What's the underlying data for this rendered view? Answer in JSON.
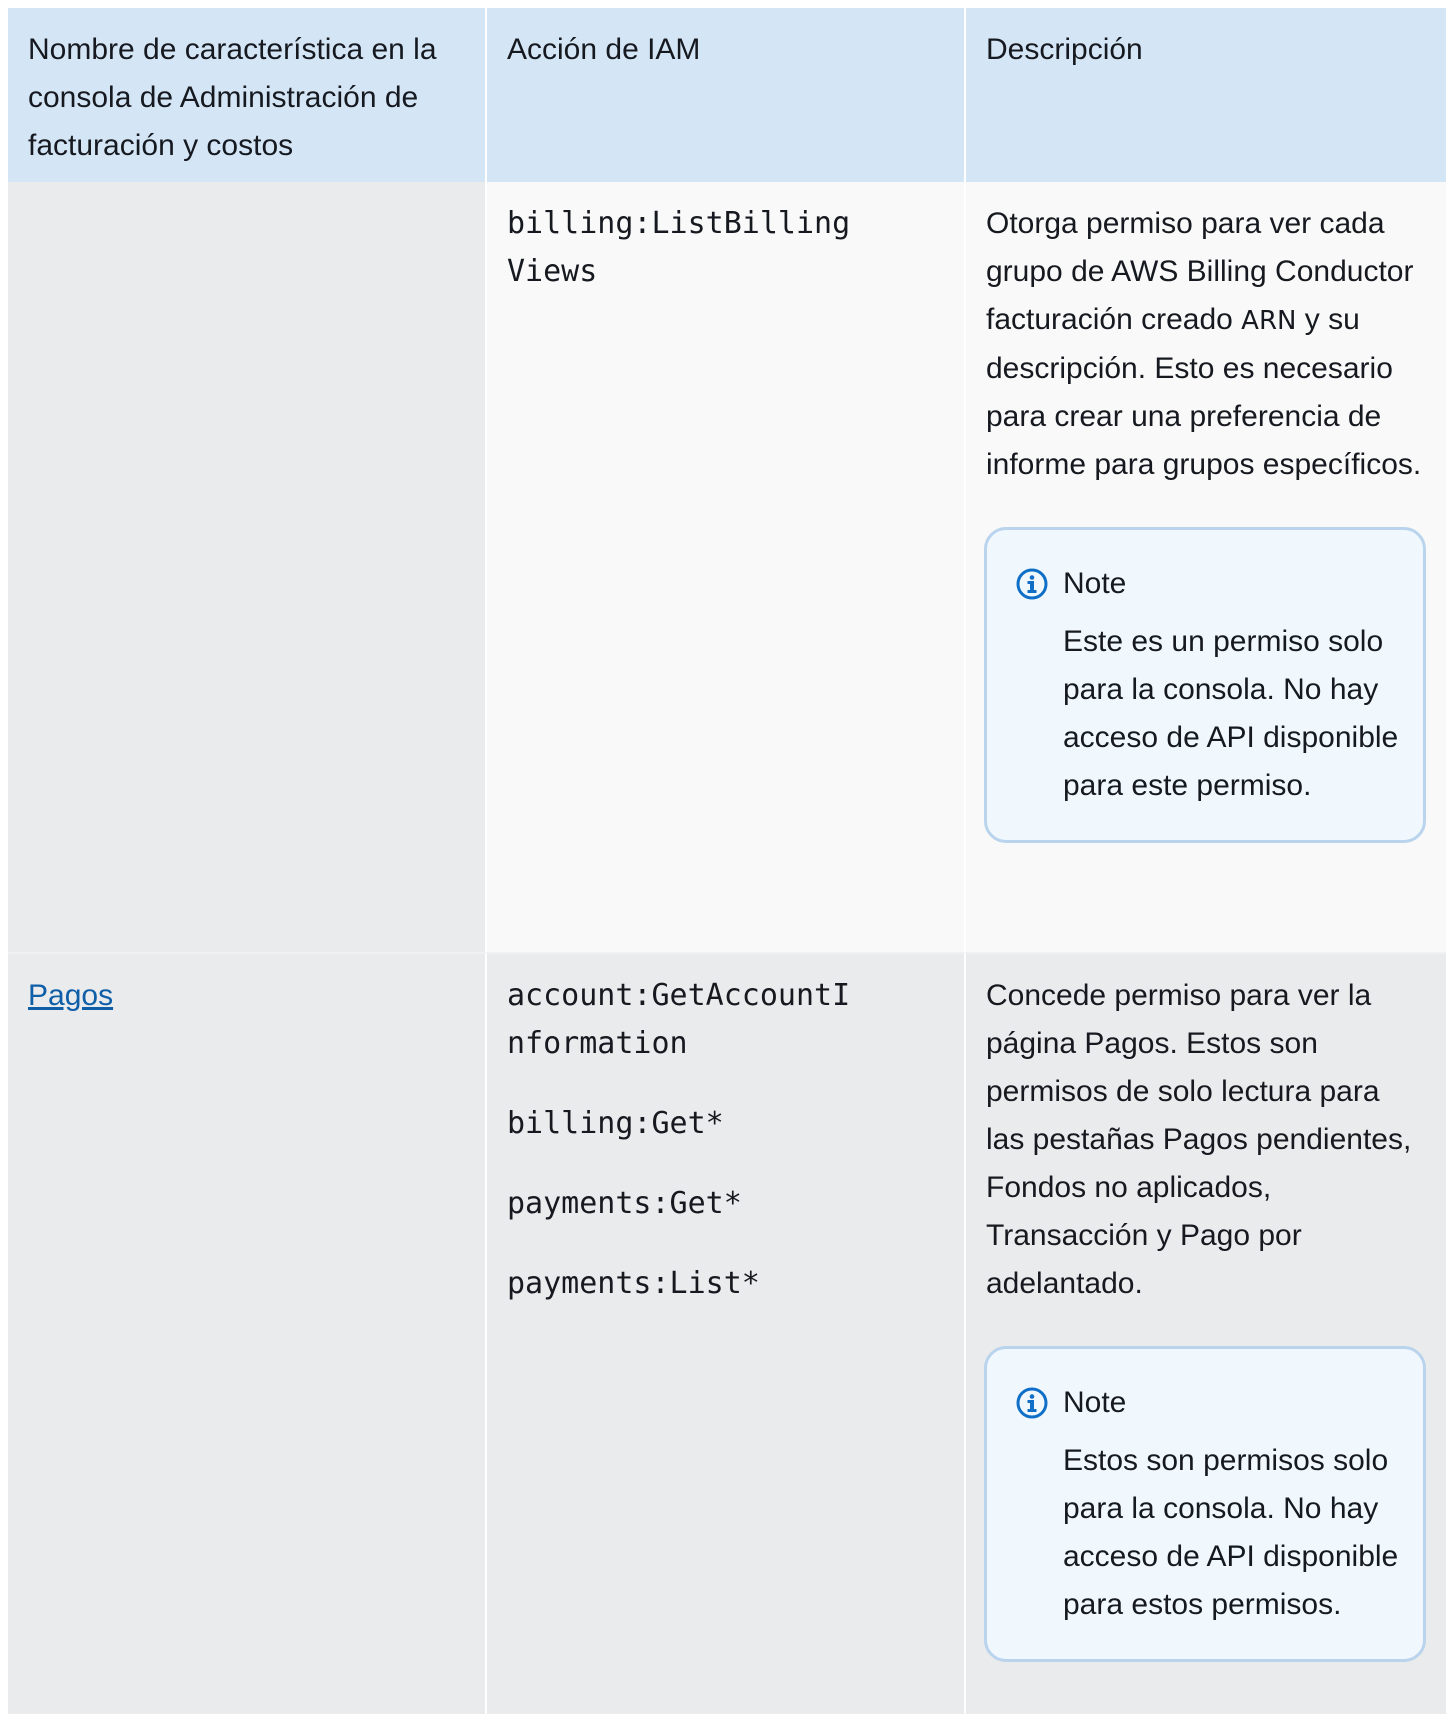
{
  "table": {
    "headers": [
      "Nombre de característica en la consola de Administración de facturación y costos",
      "Acción de IAM",
      "Descripción"
    ],
    "rows": [
      {
        "feature": "",
        "actions": [
          "billing:ListBillingViews"
        ],
        "description_parts": [
          "Otorga permiso para ver cada grupo de AWS Billing Conductor facturación creado ",
          "ARN",
          " y su descripción. Esto es necesario para crear una preferencia de informe para grupos específicos."
        ],
        "note": {
          "title": "Note",
          "body": "Este es un permiso solo para la consola. No hay acceso de API disponible para este permiso."
        }
      },
      {
        "feature": "Pagos",
        "actions": [
          "account:GetAccountInformation",
          "billing:Get*",
          "payments:Get*",
          "payments:List*"
        ],
        "description": "Concede permiso para ver la página Pagos. Estos son permisos de solo lectura para las pestañas Pagos pendientes, Fondos no aplicados, Transacción y Pago por adelantado.",
        "note": {
          "title": "Note",
          "body": "Estos son permisos solo para la consola. No hay acceso de API disponible para estos permisos."
        }
      }
    ]
  },
  "colors": {
    "header_bg": "#d4e6f6",
    "link": "#0f5ea8",
    "note_border": "#b9d4ec",
    "note_bg": "#f0f8fe",
    "info_icon": "#0f6fc6"
  },
  "icons": [
    "info-icon"
  ]
}
